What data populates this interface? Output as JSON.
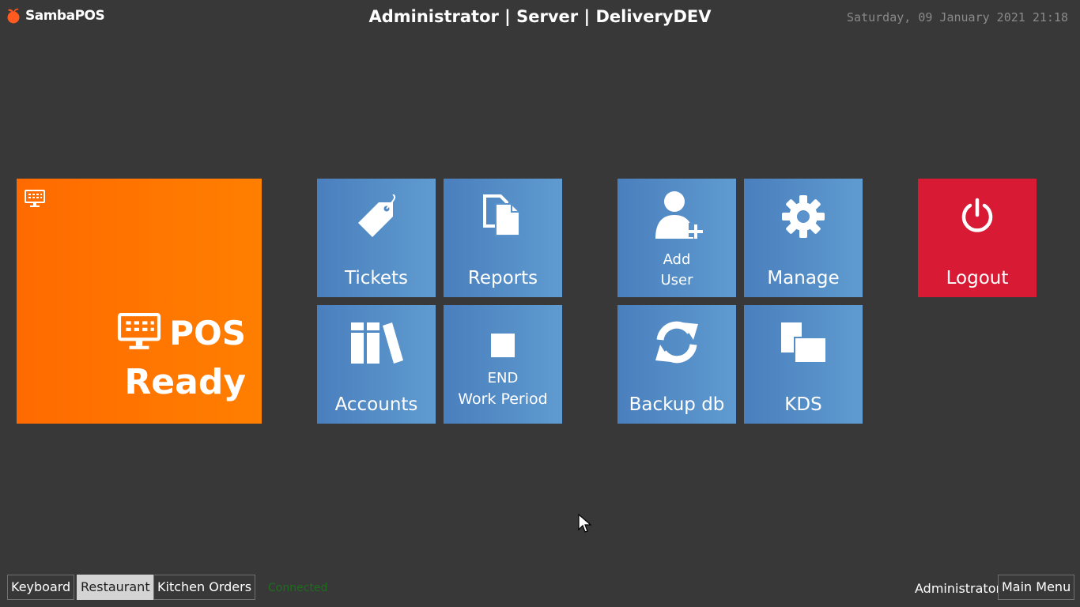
{
  "header": {
    "app_name": "SambaPOS",
    "title": "Administrator | Server | DeliveryDEV",
    "datetime": "Saturday, 09 January 2021 21:18"
  },
  "pos_tile": {
    "line1": "POS",
    "line2": "Ready",
    "color": "#ff7200"
  },
  "tiles": {
    "tickets": "Tickets",
    "reports": "Reports",
    "accounts": "Accounts",
    "end_work_period": {
      "line1": "END",
      "line2": "Work Period"
    },
    "add_user": {
      "line1": "Add",
      "line2": "User"
    },
    "manage": "Manage",
    "backup": "Backup db",
    "kds": "KDS",
    "logout": "Logout"
  },
  "colors": {
    "background": "#383838",
    "tile_blue": "#5a93cc",
    "logout_red": "#d81a35",
    "connected_green": "#1c6e1c"
  },
  "footer": {
    "buttons": [
      "Keyboard",
      "Restaurant",
      "Kitchen Orders"
    ],
    "selected": "Restaurant",
    "status": "Connected",
    "user": "Administrator",
    "main_menu": "Main Menu"
  }
}
